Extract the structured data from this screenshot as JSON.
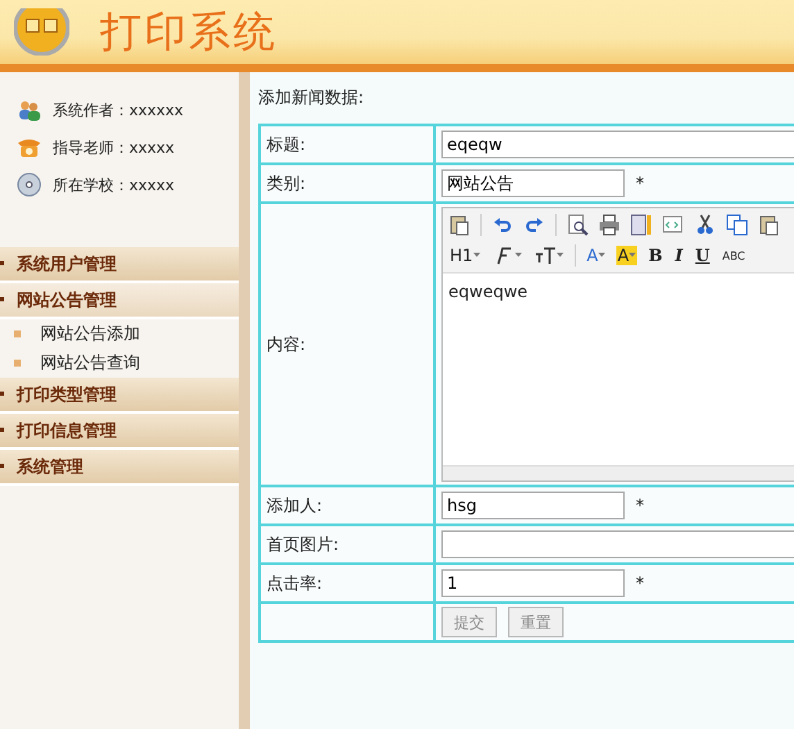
{
  "header": {
    "title": "打印系统"
  },
  "sidebar": {
    "info": [
      {
        "kind": "users",
        "text": "系统作者：xxxxxx"
      },
      {
        "kind": "phone",
        "text": "指导老师：xxxxx"
      },
      {
        "kind": "disc",
        "text": "所在学校：xxxxx"
      }
    ],
    "menu": [
      {
        "label": "系统用户管理",
        "expanded": false
      },
      {
        "label": "网站公告管理",
        "expanded": true,
        "children": [
          {
            "label": "网站公告添加"
          },
          {
            "label": "网站公告查询"
          }
        ]
      },
      {
        "label": "打印类型管理",
        "expanded": false
      },
      {
        "label": "打印信息管理",
        "expanded": false
      },
      {
        "label": "系统管理",
        "expanded": false
      }
    ]
  },
  "form": {
    "heading": "添加新闻数据:",
    "rows": [
      {
        "kind": "wide",
        "label": "标题:",
        "value": "eqeqw"
      },
      {
        "kind": "short",
        "label": "类别:",
        "value": "网站公告",
        "required": "*"
      },
      {
        "kind": "editor",
        "label": "内容:",
        "value": "eqweqwe"
      },
      {
        "kind": "short",
        "label": "添加人:",
        "value": "hsg",
        "required": "*"
      },
      {
        "kind": "wide",
        "label": "首页图片:",
        "value": ""
      },
      {
        "kind": "short",
        "label": "点击率:",
        "value": "1",
        "required": "*"
      },
      {
        "kind": "buttons",
        "buttons": [
          "提交",
          "重置"
        ]
      }
    ],
    "toolbar": [
      [
        {
          "kind": "paste"
        },
        {
          "kind": "sep"
        },
        {
          "kind": "undo"
        },
        {
          "kind": "redo"
        },
        {
          "kind": "sep"
        },
        {
          "kind": "preview"
        },
        {
          "kind": "print"
        },
        {
          "kind": "template"
        },
        {
          "kind": "code"
        },
        {
          "kind": "cut"
        },
        {
          "kind": "copy"
        },
        {
          "kind": "paste"
        }
      ],
      [
        {
          "kind": "text",
          "label": "H1",
          "dropdown": true
        },
        {
          "kind": "font",
          "dropdown": true
        },
        {
          "kind": "size",
          "dropdown": true
        },
        {
          "kind": "sep"
        },
        {
          "kind": "color",
          "label": "A",
          "dropdown": true
        },
        {
          "kind": "highlight",
          "label": "A",
          "dropdown": true
        },
        {
          "kind": "bold",
          "label": "B"
        },
        {
          "kind": "italic",
          "label": "I"
        },
        {
          "kind": "underline",
          "label": "U"
        },
        {
          "kind": "small",
          "label": "ABC"
        }
      ]
    ]
  }
}
